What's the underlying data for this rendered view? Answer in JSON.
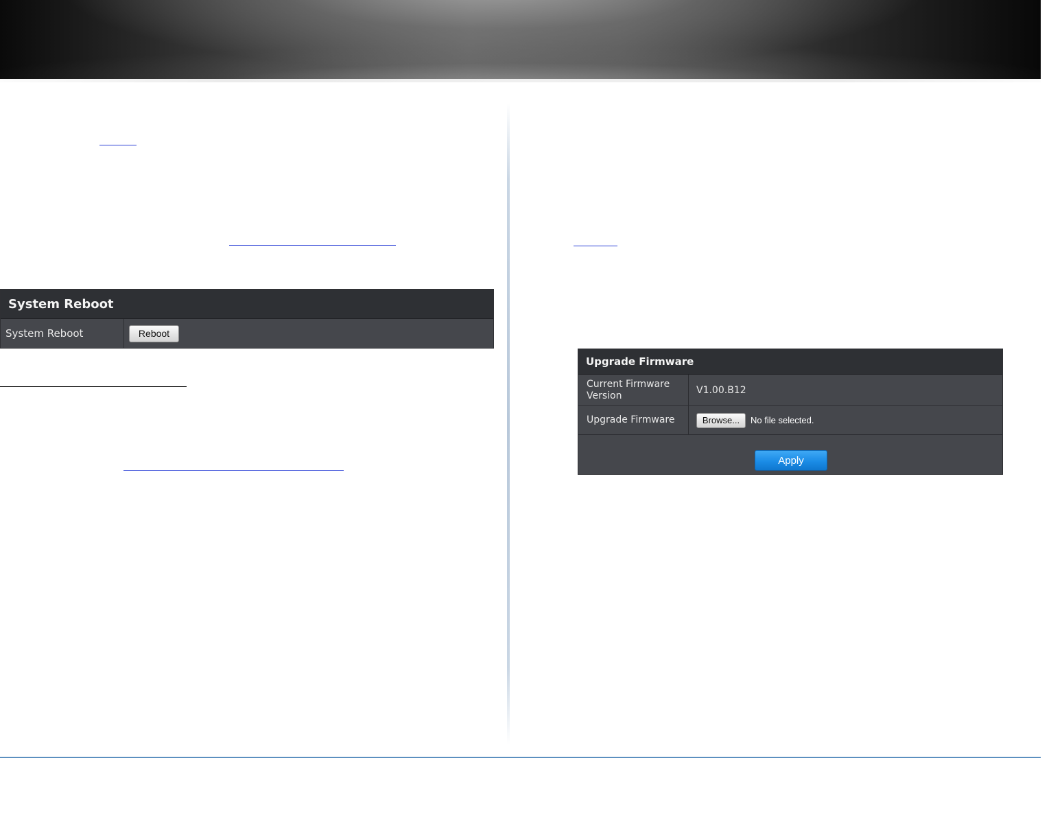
{
  "system_reboot": {
    "title": "System Reboot",
    "row_label": "System Reboot",
    "button_label": "Reboot"
  },
  "upgrade_firmware": {
    "title": "Upgrade Firmware",
    "current_version_label": "Current Firmware Version",
    "current_version_value": "V1.00.B12",
    "upgrade_label": "Upgrade Firmware",
    "browse_label": "Browse...",
    "file_status": "No file selected.",
    "apply_label": "Apply"
  },
  "colors": {
    "panel_bg": "#45474c",
    "panel_header_bg": "#2e3034",
    "apply_blue": "#1b8ce6",
    "link_blue": "#2a3fd6",
    "footer_rule": "#5b8fbf"
  }
}
